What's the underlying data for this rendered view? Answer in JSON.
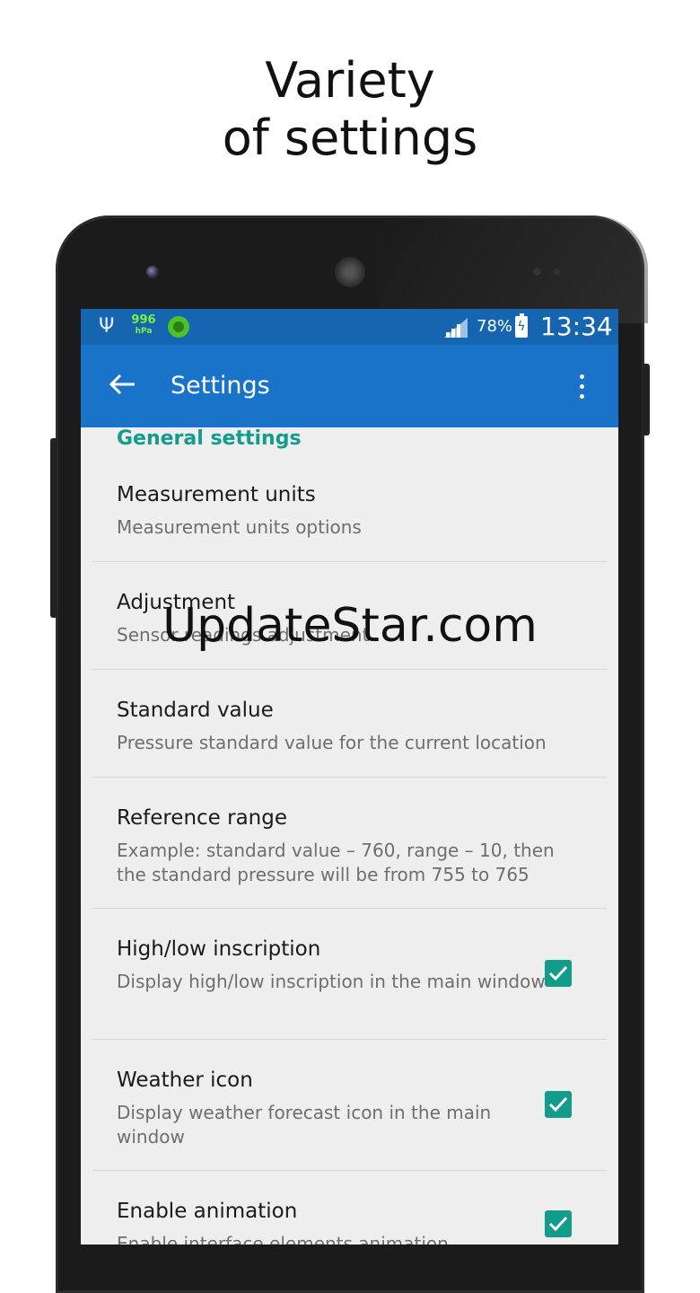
{
  "promo": {
    "line1": "Variety",
    "line2": "of settings"
  },
  "status_bar": {
    "pressure_value": "996",
    "pressure_unit": "hPa",
    "battery": "78%",
    "time": "13:34"
  },
  "app_bar": {
    "title": "Settings"
  },
  "section": {
    "title": "General settings"
  },
  "items": [
    {
      "title": "Measurement units",
      "subtitle": "Measurement units options"
    },
    {
      "title": "Adjustment",
      "subtitle": "Sensor readings adjustment"
    },
    {
      "title": "Standard value",
      "subtitle": "Pressure standard value for the current location"
    },
    {
      "title": "Reference range",
      "subtitle": "Example: standard value – 760, range – 10, then the standard pressure will be from 755 to 765"
    },
    {
      "title": "High/low inscription",
      "subtitle": "Display high/low inscription in the main window",
      "checked": true
    },
    {
      "title": "Weather icon",
      "subtitle": "Display weather forecast icon in the main window",
      "checked": true
    },
    {
      "title": "Enable animation",
      "subtitle": "Enable interface elements animation",
      "checked": true
    }
  ],
  "watermark": "UpdateStar.com",
  "colors": {
    "status_bar": "#1565b0",
    "app_bar": "#1873c9",
    "accent": "#139b8c",
    "background": "#eeeeee"
  }
}
